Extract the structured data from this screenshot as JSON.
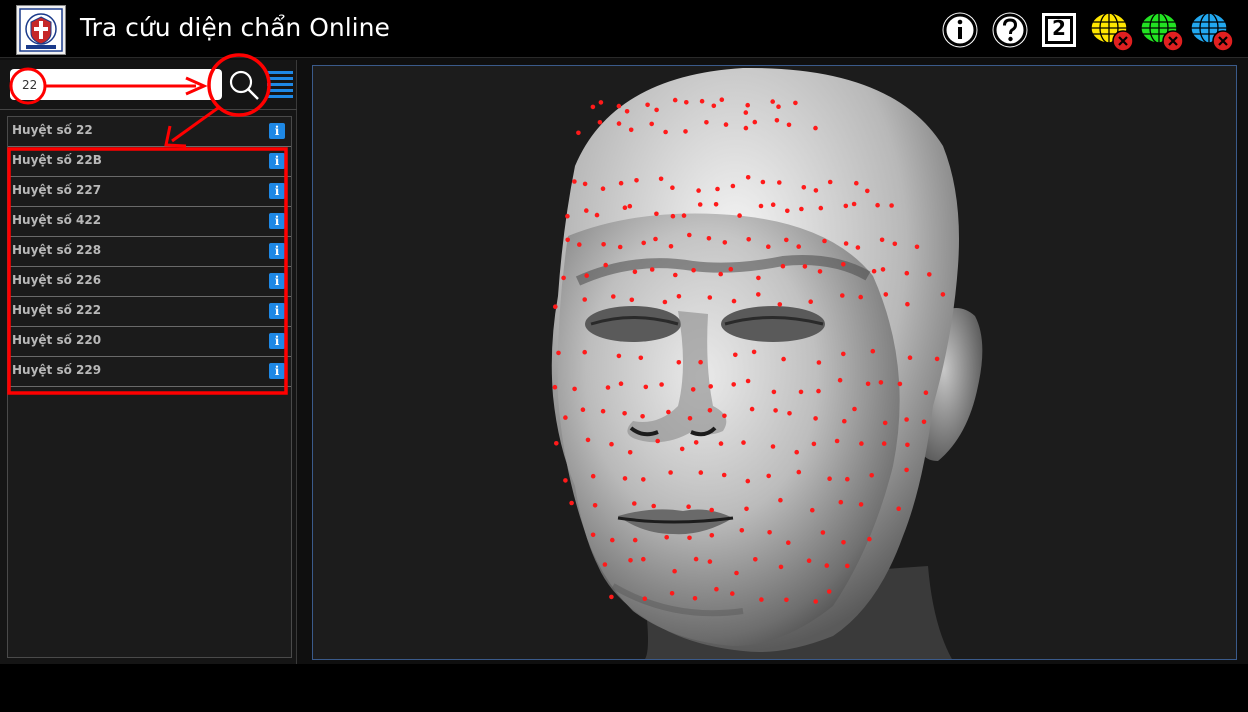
{
  "app": {
    "title": "Tra cứu diện chẩn Online",
    "logo_icon": "academy-emblem-icon"
  },
  "toolbar": {
    "info_icon": "info-circle-icon",
    "help_icon": "question-circle-icon",
    "view_number": "2",
    "layers": [
      {
        "icon": "globe-yellow-icon",
        "color": "#ffe600"
      },
      {
        "icon": "globe-green-icon",
        "color": "#22e322"
      },
      {
        "icon": "globe-blue-icon",
        "color": "#22a8f0"
      }
    ]
  },
  "search": {
    "value": "22",
    "placeholder": ""
  },
  "results": [
    {
      "label": "Huyệt số 22"
    },
    {
      "label": "Huyệt số 22B"
    },
    {
      "label": "Huyệt số 227"
    },
    {
      "label": "Huyệt số 422"
    },
    {
      "label": "Huyệt số 228"
    },
    {
      "label": "Huyệt số 226"
    },
    {
      "label": "Huyệt số 222"
    },
    {
      "label": "Huyệt số 220"
    },
    {
      "label": "Huyệt số 229"
    }
  ],
  "info_glyph": "i",
  "colors": {
    "accent_blue": "#1e88e5",
    "annotation_red": "#ff0000",
    "point_red": "#ff1a1a"
  }
}
